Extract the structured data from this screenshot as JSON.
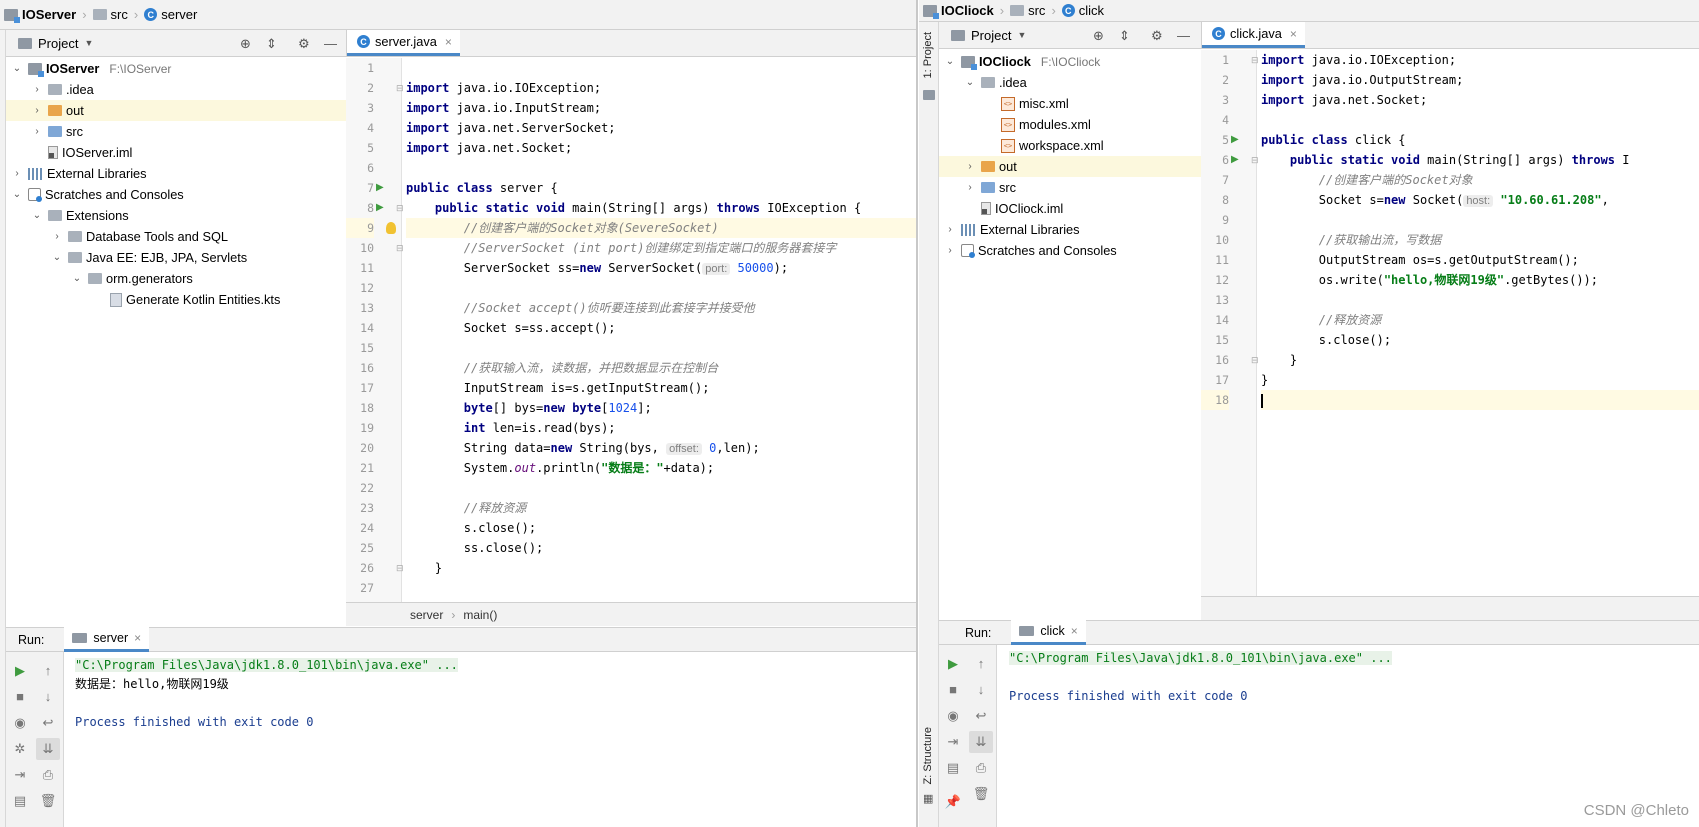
{
  "left": {
    "breadcrumb": {
      "project": "IOServer",
      "folder": "src",
      "file": "server"
    },
    "project_panel": {
      "title": "Project",
      "tree": [
        {
          "label": "IOServer",
          "path": "F:\\IOServer",
          "bold": true
        },
        {
          "label": ".idea"
        },
        {
          "label": "out"
        },
        {
          "label": "src"
        },
        {
          "label": "IOServer.iml"
        },
        {
          "label": "External Libraries"
        },
        {
          "label": "Scratches and Consoles"
        },
        {
          "label": "Extensions"
        },
        {
          "label": "Database Tools and SQL"
        },
        {
          "label": "Java EE: EJB, JPA, Servlets"
        },
        {
          "label": "orm.generators"
        },
        {
          "label": "Generate Kotlin Entities.kts"
        }
      ]
    },
    "editor": {
      "tab": "server.java",
      "lines": [
        "1",
        "2",
        "3",
        "4",
        "5",
        "6",
        "7",
        "8",
        "9",
        "10",
        "11",
        "12",
        "13",
        "14",
        "15",
        "16",
        "17",
        "18",
        "19",
        "20",
        "21",
        "22",
        "23",
        "24",
        "25",
        "26",
        "27"
      ],
      "code": {
        "l2a": "import",
        "l2b": " java.io.IOException;",
        "l3a": "import",
        "l3b": " java.io.InputStream;",
        "l4a": "import",
        "l4b": " java.net.ServerSocket;",
        "l5a": "import",
        "l5b": " java.net.Socket;",
        "l7a": "public class",
        "l7b": " server {",
        "l8a": "    public static void",
        "l8b": " main(String[] args) ",
        "l8c": "throws",
        "l8d": " IOException {",
        "l9": "        //创建客户端的Socket对象(SevereSocket)",
        "l10": "        //ServerSocket (int port)创建绑定到指定端口的服务器套接字",
        "l11a": "        ServerSocket ss=",
        "l11b": "new",
        "l11c": " ServerSocket(",
        "l11h": "port:",
        "l11d": " ",
        "l11n": "50000",
        "l11e": ");",
        "l13": "        //Socket accept()侦听要连接到此套接字并接受他",
        "l14": "        Socket s=ss.accept();",
        "l16": "        //获取输入流，读数据，并把数据显示在控制台",
        "l17": "        InputStream is=s.getInputStream();",
        "l18a": "        ",
        "l18b": "byte",
        "l18c": "[] bys=",
        "l18d": "new",
        "l18e": " ",
        "l18f": "byte",
        "l18g": "[",
        "l18n": "1024",
        "l18h": "];",
        "l19a": "        ",
        "l19b": "int",
        "l19c": " len=is.read(bys);",
        "l20a": "        String data=",
        "l20b": "new",
        "l20c": " String(bys, ",
        "l20h": "offset:",
        "l20d": " ",
        "l20n": "0",
        "l20e": ",len);",
        "l21a": "        System.",
        "l21b": "out",
        "l21c": ".println(",
        "l21s": "\"数据是：\"",
        "l21d": "+data);",
        "l23": "        //释放资源",
        "l24": "        s.close();",
        "l25": "        ss.close();",
        "l26": "    }"
      },
      "footer": {
        "class": "server",
        "method": "main()"
      }
    },
    "run": {
      "label": "Run:",
      "tab": "server",
      "console": [
        "\"C:\\Program Files\\Java\\jdk1.8.0_101\\bin\\java.exe\" ...",
        "数据是：hello,物联网19级",
        "",
        "Process finished with exit code 0"
      ]
    }
  },
  "right": {
    "breadcrumb": {
      "project": "IOCliock",
      "folder": "src",
      "file": "click"
    },
    "side_tabs": {
      "project": "1: Project",
      "structure": "Z: Structure"
    },
    "project_panel": {
      "title": "Project",
      "tree": [
        {
          "label": "IOCliock",
          "path": "F:\\IOCliock",
          "bold": true
        },
        {
          "label": ".idea"
        },
        {
          "label": "misc.xml"
        },
        {
          "label": "modules.xml"
        },
        {
          "label": "workspace.xml"
        },
        {
          "label": "out"
        },
        {
          "label": "src"
        },
        {
          "label": "IOCliock.iml"
        },
        {
          "label": "External Libraries"
        },
        {
          "label": "Scratches and Consoles"
        }
      ]
    },
    "editor": {
      "tab": "click.java",
      "lines": [
        "1",
        "2",
        "3",
        "4",
        "5",
        "6",
        "7",
        "8",
        "9",
        "10",
        "11",
        "12",
        "13",
        "14",
        "15",
        "16",
        "17",
        "18"
      ],
      "code": {
        "l1a": "import",
        "l1b": " java.io.IOException;",
        "l2a": "import",
        "l2b": " java.io.OutputStream;",
        "l3a": "import",
        "l3b": " java.net.Socket;",
        "l5a": "public class",
        "l5b": " click {",
        "l6a": "    public static void",
        "l6b": " main(String[] args) ",
        "l6c": "throws",
        "l6d": " I",
        "l7": "        //创建客户端的Socket对象",
        "l8a": "        Socket s=",
        "l8b": "new",
        "l8c": " Socket(",
        "l8h": "host:",
        "l8d": " ",
        "l8s": "\"10.60.61.208\"",
        "l8e": ",",
        "l10": "        //获取输出流，写数据",
        "l11a": "        OutputStream os=s.getOutputStream();",
        "l12a": "        os.write(",
        "l12s": "\"hello,物联网19级\"",
        "l12b": ".getBytes());",
        "l14": "        //释放资源",
        "l15": "        s.close();",
        "l16": "    }",
        "l17": "}"
      }
    },
    "run": {
      "label": "Run:",
      "tab": "click",
      "console": [
        "\"C:\\Program Files\\Java\\jdk1.8.0_101\\bin\\java.exe\" ...",
        "",
        "Process finished with exit code 0"
      ]
    }
  },
  "watermark": "CSDN @Chleto",
  "colors": {
    "keyword": "#000080",
    "comment": "#808080",
    "string": "#067d17",
    "number": "#1750eb",
    "accent": "#4a88c7"
  }
}
